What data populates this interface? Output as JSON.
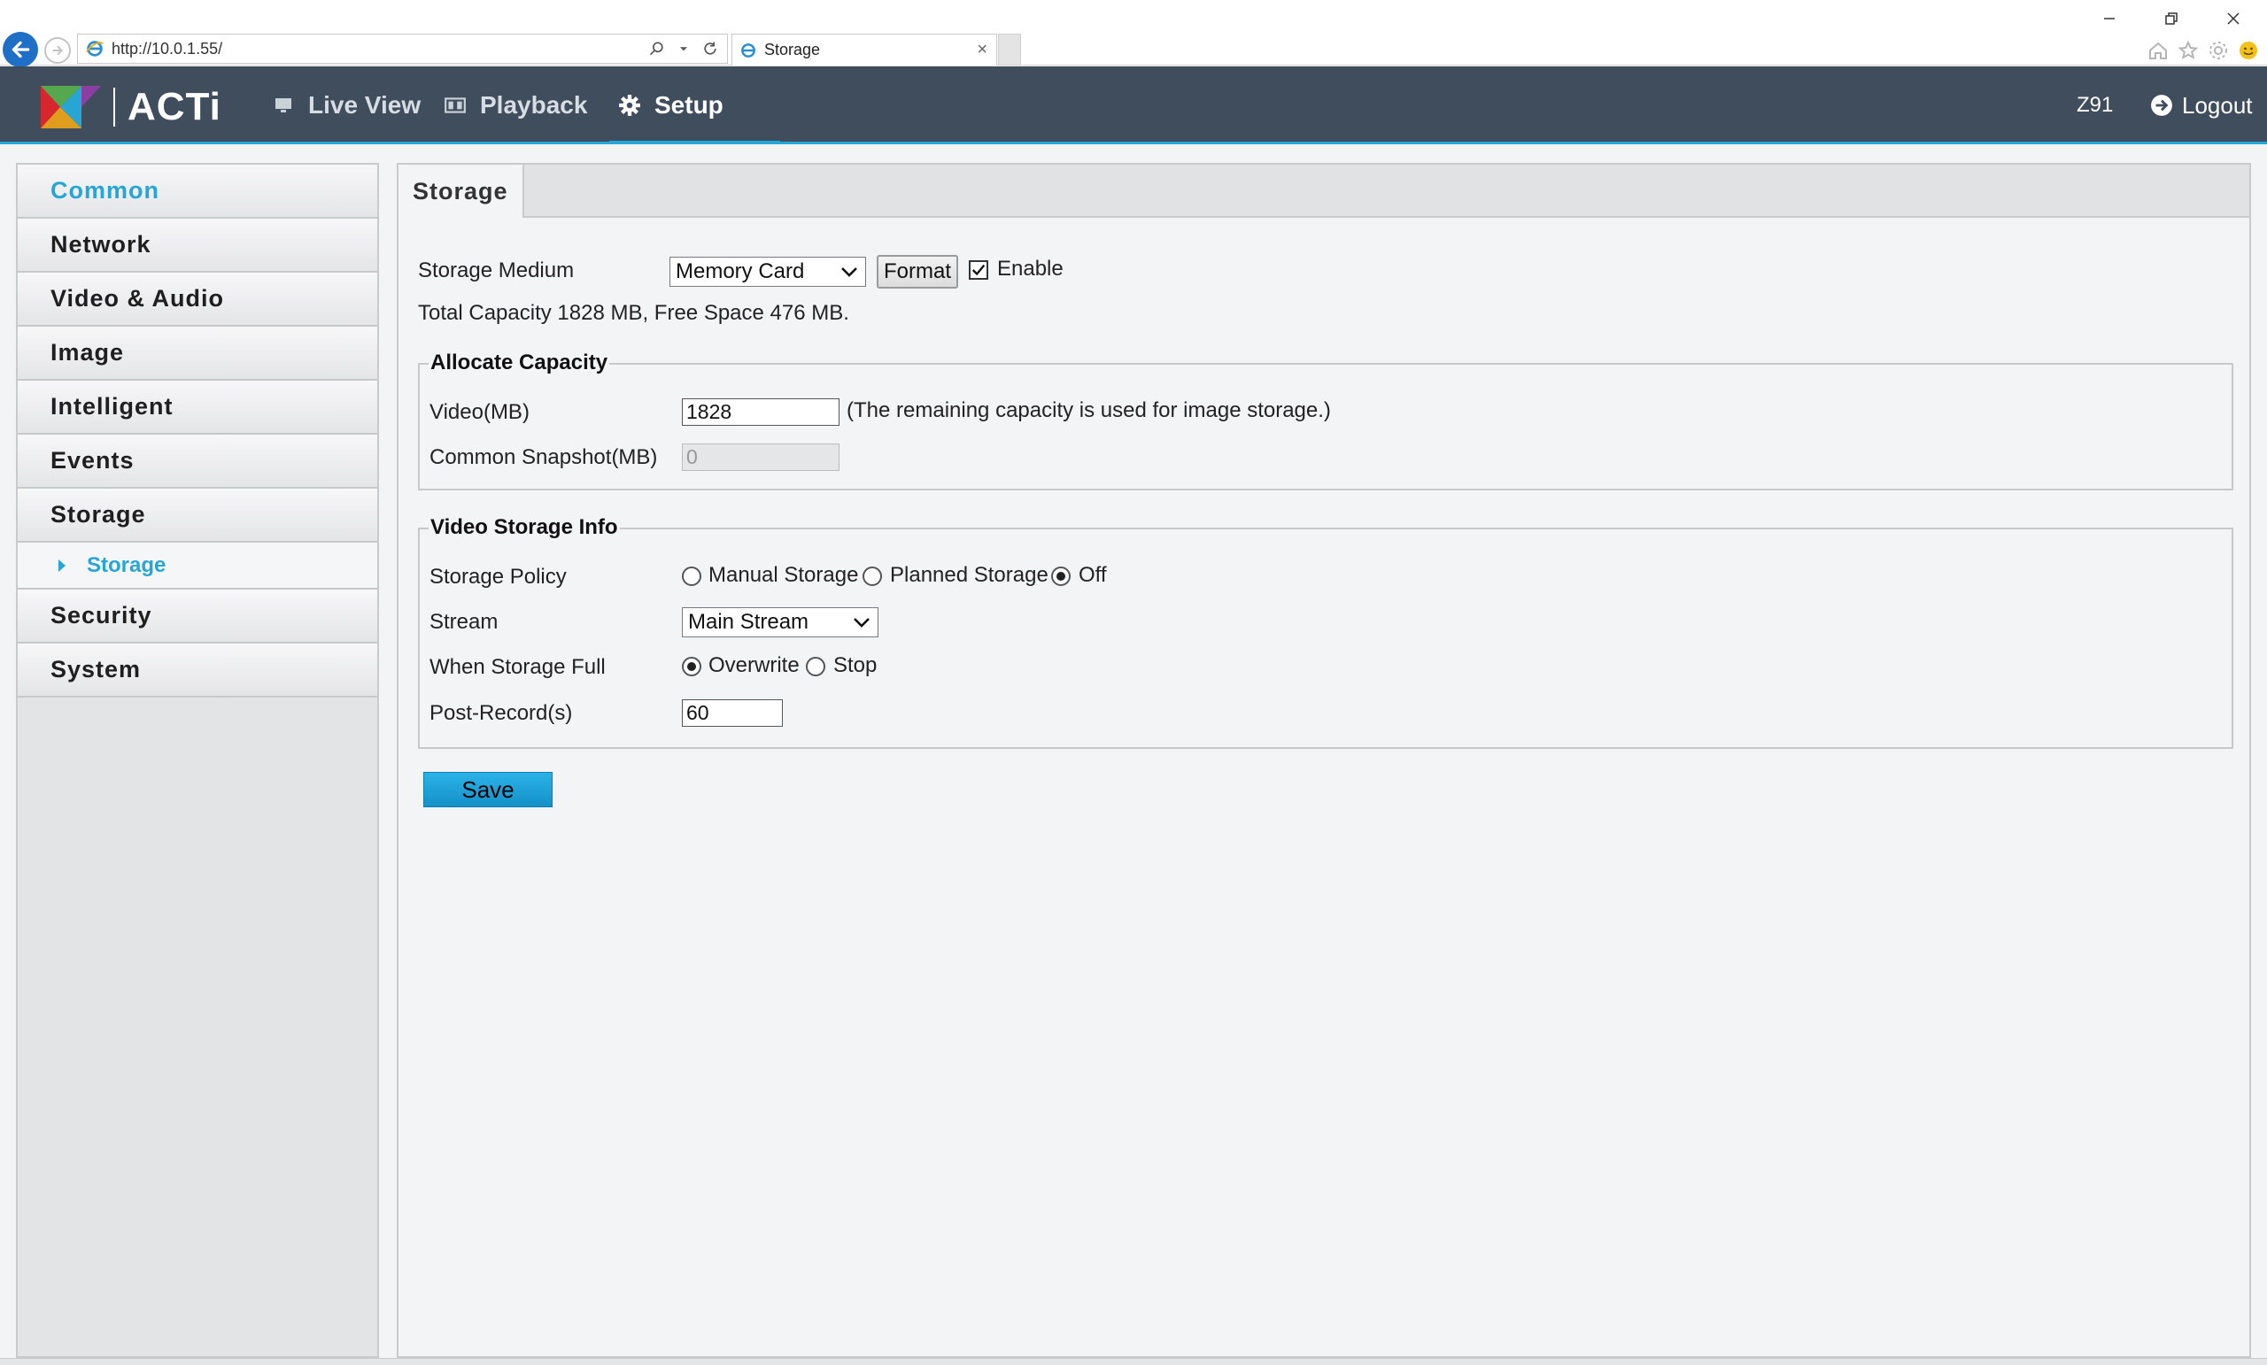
{
  "browser": {
    "url": "http://10.0.1.55/",
    "tab_title": "Storage",
    "tab_close": "×"
  },
  "header": {
    "brand": "ACTi",
    "nav": [
      {
        "label": "Live View",
        "icon": "monitor-icon"
      },
      {
        "label": "Playback",
        "icon": "film-icon"
      },
      {
        "label": "Setup",
        "icon": "gear-icon"
      }
    ],
    "user": "Z91",
    "logout": "Logout",
    "accent": "#27a6d6",
    "bg": "#3f4d5c"
  },
  "sidebar": {
    "items": [
      {
        "label": "Common"
      },
      {
        "label": "Network"
      },
      {
        "label": "Video & Audio"
      },
      {
        "label": "Image"
      },
      {
        "label": "Intelligent"
      },
      {
        "label": "Events"
      },
      {
        "label": "Storage"
      },
      {
        "label": "Security"
      },
      {
        "label": "System"
      }
    ],
    "sub": {
      "label": "Storage"
    }
  },
  "content": {
    "tab": "Storage",
    "storage_medium": {
      "label": "Storage Medium",
      "value": "Memory Card",
      "format_label": "Format",
      "enable_label": "Enable",
      "enabled": true
    },
    "capacity_text": "Total Capacity  1828  MB, Free Space  476  MB.",
    "allocate": {
      "legend": "Allocate Capacity",
      "video_label": "Video(MB)",
      "video_value": "1828",
      "video_note": "(The remaining capacity is used for image storage.)",
      "snapshot_label": "Common Snapshot(MB)",
      "snapshot_value": "0"
    },
    "video_info": {
      "legend": "Video Storage Info",
      "policy_label": "Storage Policy",
      "policy_options": [
        "Manual Storage",
        "Planned Storage",
        "Off"
      ],
      "policy_selected": "Off",
      "stream_label": "Stream",
      "stream_value": "Main Stream",
      "full_label": "When Storage Full",
      "full_options": [
        "Overwrite",
        "Stop"
      ],
      "full_selected": "Overwrite",
      "post_label": "Post-Record(s)",
      "post_value": "60"
    },
    "save_label": "Save"
  }
}
